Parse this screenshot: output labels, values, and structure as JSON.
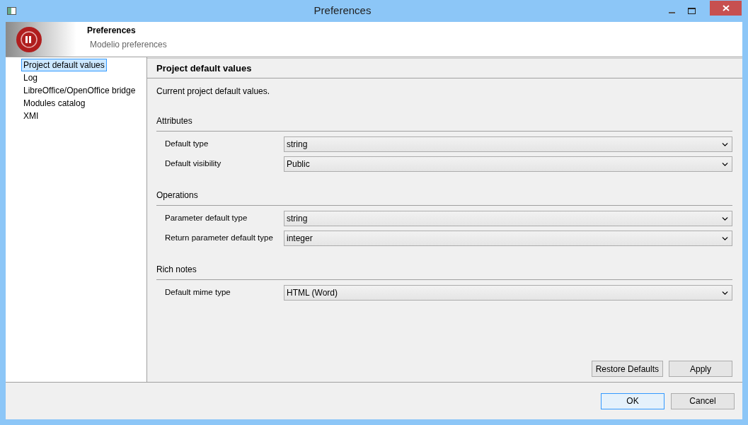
{
  "window": {
    "title": "Preferences"
  },
  "header": {
    "title": "Preferences",
    "subtitle": "Modelio preferences"
  },
  "sidebar": {
    "items": [
      {
        "label": "Project default values",
        "selected": true
      },
      {
        "label": "Log",
        "selected": false
      },
      {
        "label": "LibreOffice/OpenOffice bridge",
        "selected": false
      },
      {
        "label": "Modules catalog",
        "selected": false
      },
      {
        "label": "XMI",
        "selected": false
      }
    ]
  },
  "page": {
    "title": "Project default values",
    "description": "Current project default values.",
    "sections": [
      {
        "title": "Attributes",
        "fields": [
          {
            "label": "Default type",
            "value": "string"
          },
          {
            "label": "Default visibility",
            "value": "Public"
          }
        ]
      },
      {
        "title": "Operations",
        "fields": [
          {
            "label": "Parameter default type",
            "value": "string"
          },
          {
            "label": "Return parameter default type",
            "value": "integer"
          }
        ]
      },
      {
        "title": "Rich notes",
        "fields": [
          {
            "label": "Default mime type",
            "value": "HTML (Word)"
          }
        ]
      }
    ],
    "buttons": [
      "Restore Defaults",
      "Apply"
    ]
  },
  "dialog_buttons": [
    {
      "label": "OK",
      "focused": true
    },
    {
      "label": "Cancel",
      "focused": false
    }
  ]
}
